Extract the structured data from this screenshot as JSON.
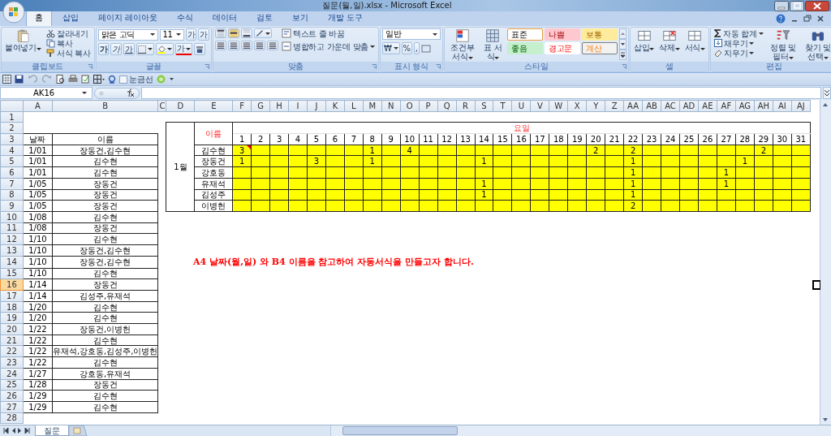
{
  "window": {
    "title": "질문(월,일).xlsx - Microsoft Excel"
  },
  "tabs": [
    {
      "label": "홈",
      "selected": true
    },
    {
      "label": "삽입",
      "selected": false
    },
    {
      "label": "페이지 레이아웃",
      "selected": false
    },
    {
      "label": "수식",
      "selected": false
    },
    {
      "label": "데이터",
      "selected": false
    },
    {
      "label": "검토",
      "selected": false
    },
    {
      "label": "보기",
      "selected": false
    },
    {
      "label": "개발 도구",
      "selected": false
    }
  ],
  "ribbon": {
    "clipboard": {
      "label": "클립보드",
      "paste": "붙여넣기",
      "cut": "잘라내기",
      "copy": "복사",
      "format_painter": "서식 복사"
    },
    "font": {
      "label": "글꼴",
      "font_name": "맑은 고딕",
      "font_size": "11",
      "size_buttons": [
        "가",
        "가"
      ],
      "style_buttons": [
        "가",
        "가",
        "가"
      ],
      "font_color": "가"
    },
    "alignment": {
      "label": "맞춤",
      "wrap_text": "텍스트 줄 바꿈",
      "merge": "병합하고 가운데 맞춤"
    },
    "number": {
      "label": "표시 형식",
      "format": "일반",
      "buttons": [
        "₩",
        "%",
        ","
      ]
    },
    "styles": {
      "label": "스타일",
      "conditional": "조건부 서식",
      "table": "표 서식",
      "cell_styles": [
        {
          "label": "표준",
          "kind": "normal"
        },
        {
          "label": "나쁨",
          "kind": "bad"
        },
        {
          "label": "보통",
          "kind": "neutral"
        },
        {
          "label": "좋음",
          "kind": "good"
        },
        {
          "label": "경고문",
          "kind": "warning"
        },
        {
          "label": "계산",
          "kind": "calc"
        }
      ]
    },
    "cells": {
      "label": "셀",
      "buttons": [
        "삽입",
        "삭제",
        "서식"
      ]
    },
    "editing": {
      "label": "편집",
      "autosum": "자동 합계",
      "fill": "채우기",
      "clear": "지우기",
      "sort": "정렬 및 필터",
      "find": "찾기 및 선택"
    }
  },
  "quick_access": {
    "gridlines": {
      "label": "눈금선",
      "checked": false
    }
  },
  "formula_bar": {
    "name_box": "AK16"
  },
  "sheet": {
    "columns": [
      "A",
      "B",
      "C",
      "D",
      "E",
      "F",
      "G",
      "H",
      "I",
      "J",
      "K",
      "L",
      "M",
      "N",
      "O",
      "P",
      "Q",
      "R",
      "S",
      "T",
      "U",
      "V",
      "W",
      "X",
      "Y",
      "Z",
      "AA",
      "AB",
      "AC",
      "AD",
      "AE",
      "AF",
      "AG",
      "AH",
      "AI",
      "AJ"
    ],
    "rows": [
      {
        "label": "1",
        "selected": false
      },
      {
        "label": "2",
        "selected": false
      },
      {
        "label": "3",
        "selected": false
      },
      {
        "label": "4",
        "selected": false
      },
      {
        "label": "5",
        "selected": false
      },
      {
        "label": "6",
        "selected": false
      },
      {
        "label": "7",
        "selected": false
      },
      {
        "label": "8",
        "selected": false
      },
      {
        "label": "9",
        "selected": false
      },
      {
        "label": "10",
        "selected": false
      },
      {
        "label": "11",
        "selected": false
      },
      {
        "label": "12",
        "selected": false
      },
      {
        "label": "13",
        "selected": false
      },
      {
        "label": "14",
        "selected": false
      },
      {
        "label": "15",
        "selected": false
      },
      {
        "label": "16",
        "selected": true
      },
      {
        "label": "17",
        "selected": false
      },
      {
        "label": "18",
        "selected": false
      },
      {
        "label": "19",
        "selected": false
      },
      {
        "label": "20",
        "selected": false
      },
      {
        "label": "21",
        "selected": false
      },
      {
        "label": "22",
        "selected": false
      },
      {
        "label": "23",
        "selected": false
      },
      {
        "label": "24",
        "selected": false
      },
      {
        "label": "25",
        "selected": false
      },
      {
        "label": "26",
        "selected": false
      },
      {
        "label": "27",
        "selected": false
      },
      {
        "label": "28",
        "selected": false
      }
    ],
    "list": {
      "headers": [
        "날짜",
        "이름"
      ],
      "rows": [
        {
          "date": "1/01",
          "names": "장동건,김수현"
        },
        {
          "date": "1/01",
          "names": "김수현"
        },
        {
          "date": "1/01",
          "names": "김수현"
        },
        {
          "date": "1/05",
          "names": "장동건"
        },
        {
          "date": "1/05",
          "names": "장동건"
        },
        {
          "date": "1/05",
          "names": "장동건"
        },
        {
          "date": "1/08",
          "names": "김수현"
        },
        {
          "date": "1/08",
          "names": "장동건"
        },
        {
          "date": "1/10",
          "names": "김수현"
        },
        {
          "date": "1/10",
          "names": "장동건,김수현"
        },
        {
          "date": "1/10",
          "names": "장동건,김수현"
        },
        {
          "date": "1/10",
          "names": "김수현"
        },
        {
          "date": "1/14",
          "names": "장동건"
        },
        {
          "date": "1/14",
          "names": "김성주,유재석"
        },
        {
          "date": "1/20",
          "names": "김수현"
        },
        {
          "date": "1/20",
          "names": "김수현"
        },
        {
          "date": "1/22",
          "names": "장동건,이병헌"
        },
        {
          "date": "1/22",
          "names": "김수현"
        },
        {
          "date": "1/22",
          "names": "유재석,강호동,김성주,이병헌"
        },
        {
          "date": "1/22",
          "names": "김수현"
        },
        {
          "date": "1/27",
          "names": "강호동,유재석"
        },
        {
          "date": "1/28",
          "names": "장동건"
        },
        {
          "date": "1/29",
          "names": "김수현"
        },
        {
          "date": "1/29",
          "names": "김수현"
        }
      ]
    },
    "summary": {
      "month": "1월",
      "name_header": "이름",
      "day_header": "요일",
      "days": [
        "1",
        "2",
        "3",
        "4",
        "5",
        "6",
        "7",
        "8",
        "9",
        "10",
        "11",
        "12",
        "13",
        "14",
        "15",
        "16",
        "17",
        "18",
        "19",
        "20",
        "21",
        "22",
        "23",
        "24",
        "25",
        "26",
        "27",
        "28",
        "29",
        "30",
        "31"
      ],
      "people": [
        {
          "name": "김수현",
          "comment": true,
          "cells": [
            {
              "highlighted": true,
              "count": "3"
            },
            {
              "highlighted": true
            },
            {
              "highlighted": true
            },
            {
              "highlighted": true
            },
            {
              "highlighted": true
            },
            {
              "highlighted": true
            },
            {
              "highlighted": true
            },
            {
              "highlighted": true,
              "count": "1"
            },
            {
              "highlighted": true
            },
            {
              "highlighted": true,
              "count": "4"
            },
            {
              "highlighted": true
            },
            {
              "highlighted": true
            },
            {
              "highlighted": true
            },
            {
              "highlighted": true
            },
            {
              "highlighted": true
            },
            {
              "highlighted": true
            },
            {
              "highlighted": true
            },
            {
              "highlighted": true
            },
            {
              "highlighted": true
            },
            {
              "highlighted": true,
              "count": "2"
            },
            {
              "highlighted": true
            },
            {
              "highlighted": true,
              "count": "2"
            },
            {
              "highlighted": true
            },
            {
              "highlighted": true
            },
            {
              "highlighted": true
            },
            {
              "highlighted": true
            },
            {
              "highlighted": true
            },
            {
              "highlighted": true
            },
            {
              "highlighted": true,
              "count": "2"
            },
            {
              "highlighted": true
            },
            {
              "highlighted": true
            }
          ]
        },
        {
          "name": "장동건",
          "comment": false,
          "cells": [
            {
              "highlighted": true,
              "count": "1"
            },
            {
              "highlighted": true
            },
            {
              "highlighted": true
            },
            {
              "highlighted": true
            },
            {
              "highlighted": true,
              "count": "3"
            },
            {
              "highlighted": true
            },
            {
              "highlighted": true
            },
            {
              "highlighted": true,
              "count": "1"
            },
            {
              "highlighted": true
            },
            {
              "highlighted": true
            },
            {
              "highlighted": true
            },
            {
              "highlighted": true
            },
            {
              "highlighted": true
            },
            {
              "highlighted": true,
              "count": "1"
            },
            {
              "highlighted": true
            },
            {
              "highlighted": true
            },
            {
              "highlighted": true
            },
            {
              "highlighted": true
            },
            {
              "highlighted": true
            },
            {
              "highlighted": true
            },
            {
              "highlighted": true
            },
            {
              "highlighted": true,
              "count": "1"
            },
            {
              "highlighted": true
            },
            {
              "highlighted": true
            },
            {
              "highlighted": true
            },
            {
              "highlighted": true
            },
            {
              "highlighted": true
            },
            {
              "highlighted": true,
              "count": "1"
            },
            {
              "highlighted": true
            },
            {
              "highlighted": true
            },
            {
              "highlighted": true
            }
          ]
        },
        {
          "name": "강호동",
          "comment": false,
          "cells": [
            {
              "highlighted": true
            },
            {
              "highlighted": true
            },
            {
              "highlighted": true
            },
            {
              "highlighted": true
            },
            {
              "highlighted": true
            },
            {
              "highlighted": true
            },
            {
              "highlighted": true
            },
            {
              "highlighted": true
            },
            {
              "highlighted": true
            },
            {
              "highlighted": true
            },
            {
              "highlighted": true
            },
            {
              "highlighted": true
            },
            {
              "highlighted": true
            },
            {
              "highlighted": true
            },
            {
              "highlighted": true
            },
            {
              "highlighted": true
            },
            {
              "highlighted": true
            },
            {
              "highlighted": true
            },
            {
              "highlighted": true
            },
            {
              "highlighted": true
            },
            {
              "highlighted": true
            },
            {
              "highlighted": true,
              "count": "1"
            },
            {
              "highlighted": true
            },
            {
              "highlighted": true
            },
            {
              "highlighted": true
            },
            {
              "highlighted": true
            },
            {
              "highlighted": true,
              "count": "1"
            },
            {
              "highlighted": true
            },
            {
              "highlighted": true
            },
            {
              "highlighted": true
            },
            {
              "highlighted": true
            }
          ]
        },
        {
          "name": "유재석",
          "comment": false,
          "cells": [
            {
              "highlighted": true
            },
            {
              "highlighted": true
            },
            {
              "highlighted": true
            },
            {
              "highlighted": true
            },
            {
              "highlighted": true
            },
            {
              "highlighted": true
            },
            {
              "highlighted": true
            },
            {
              "highlighted": true
            },
            {
              "highlighted": true
            },
            {
              "highlighted": true
            },
            {
              "highlighted": true
            },
            {
              "highlighted": true
            },
            {
              "highlighted": true
            },
            {
              "highlighted": true,
              "count": "1"
            },
            {
              "highlighted": true
            },
            {
              "highlighted": true
            },
            {
              "highlighted": true
            },
            {
              "highlighted": true
            },
            {
              "highlighted": true
            },
            {
              "highlighted": true
            },
            {
              "highlighted": true
            },
            {
              "highlighted": true,
              "count": "1"
            },
            {
              "highlighted": true
            },
            {
              "highlighted": true
            },
            {
              "highlighted": true
            },
            {
              "highlighted": true
            },
            {
              "highlighted": true,
              "count": "1"
            },
            {
              "highlighted": true
            },
            {
              "highlighted": true
            },
            {
              "highlighted": true
            },
            {
              "highlighted": true
            }
          ]
        },
        {
          "name": "김성주",
          "comment": false,
          "cells": [
            {
              "highlighted": true
            },
            {
              "highlighted": true
            },
            {
              "highlighted": true
            },
            {
              "highlighted": true
            },
            {
              "highlighted": true
            },
            {
              "highlighted": true
            },
            {
              "highlighted": true
            },
            {
              "highlighted": true
            },
            {
              "highlighted": true
            },
            {
              "highlighted": true
            },
            {
              "highlighted": true
            },
            {
              "highlighted": true
            },
            {
              "highlighted": true
            },
            {
              "highlighted": true,
              "count": "1"
            },
            {
              "highlighted": true
            },
            {
              "highlighted": true
            },
            {
              "highlighted": true
            },
            {
              "highlighted": true
            },
            {
              "highlighted": true
            },
            {
              "highlighted": true
            },
            {
              "highlighted": true
            },
            {
              "highlighted": true,
              "count": "1"
            },
            {
              "highlighted": true
            },
            {
              "highlighted": true
            },
            {
              "highlighted": true
            },
            {
              "highlighted": true
            },
            {
              "highlighted": true
            },
            {
              "highlighted": true
            },
            {
              "highlighted": true
            },
            {
              "highlighted": true
            },
            {
              "highlighted": true
            }
          ]
        },
        {
          "name": "이병헌",
          "comment": false,
          "cells": [
            {
              "highlighted": true
            },
            {
              "highlighted": true
            },
            {
              "highlighted": true
            },
            {
              "highlighted": true
            },
            {
              "highlighted": true
            },
            {
              "highlighted": true
            },
            {
              "highlighted": true
            },
            {
              "highlighted": true
            },
            {
              "highlighted": true
            },
            {
              "highlighted": true
            },
            {
              "highlighted": true
            },
            {
              "highlighted": true
            },
            {
              "highlighted": true
            },
            {
              "highlighted": true
            },
            {
              "highlighted": true
            },
            {
              "highlighted": true
            },
            {
              "highlighted": true
            },
            {
              "highlighted": true
            },
            {
              "highlighted": true
            },
            {
              "highlighted": true
            },
            {
              "highlighted": true
            },
            {
              "highlighted": true,
              "count": "2"
            },
            {
              "highlighted": true
            },
            {
              "highlighted": true
            },
            {
              "highlighted": true
            },
            {
              "highlighted": true
            },
            {
              "highlighted": true
            },
            {
              "highlighted": true
            },
            {
              "highlighted": true
            },
            {
              "highlighted": true
            },
            {
              "highlighted": true
            }
          ]
        }
      ]
    },
    "note": "A4 날짜(월,일) 와 B4 이름을 참고하여 자동서식을 만들고자 합니다."
  },
  "sheet_tabs": [
    {
      "label": "질문",
      "selected": true
    }
  ]
}
